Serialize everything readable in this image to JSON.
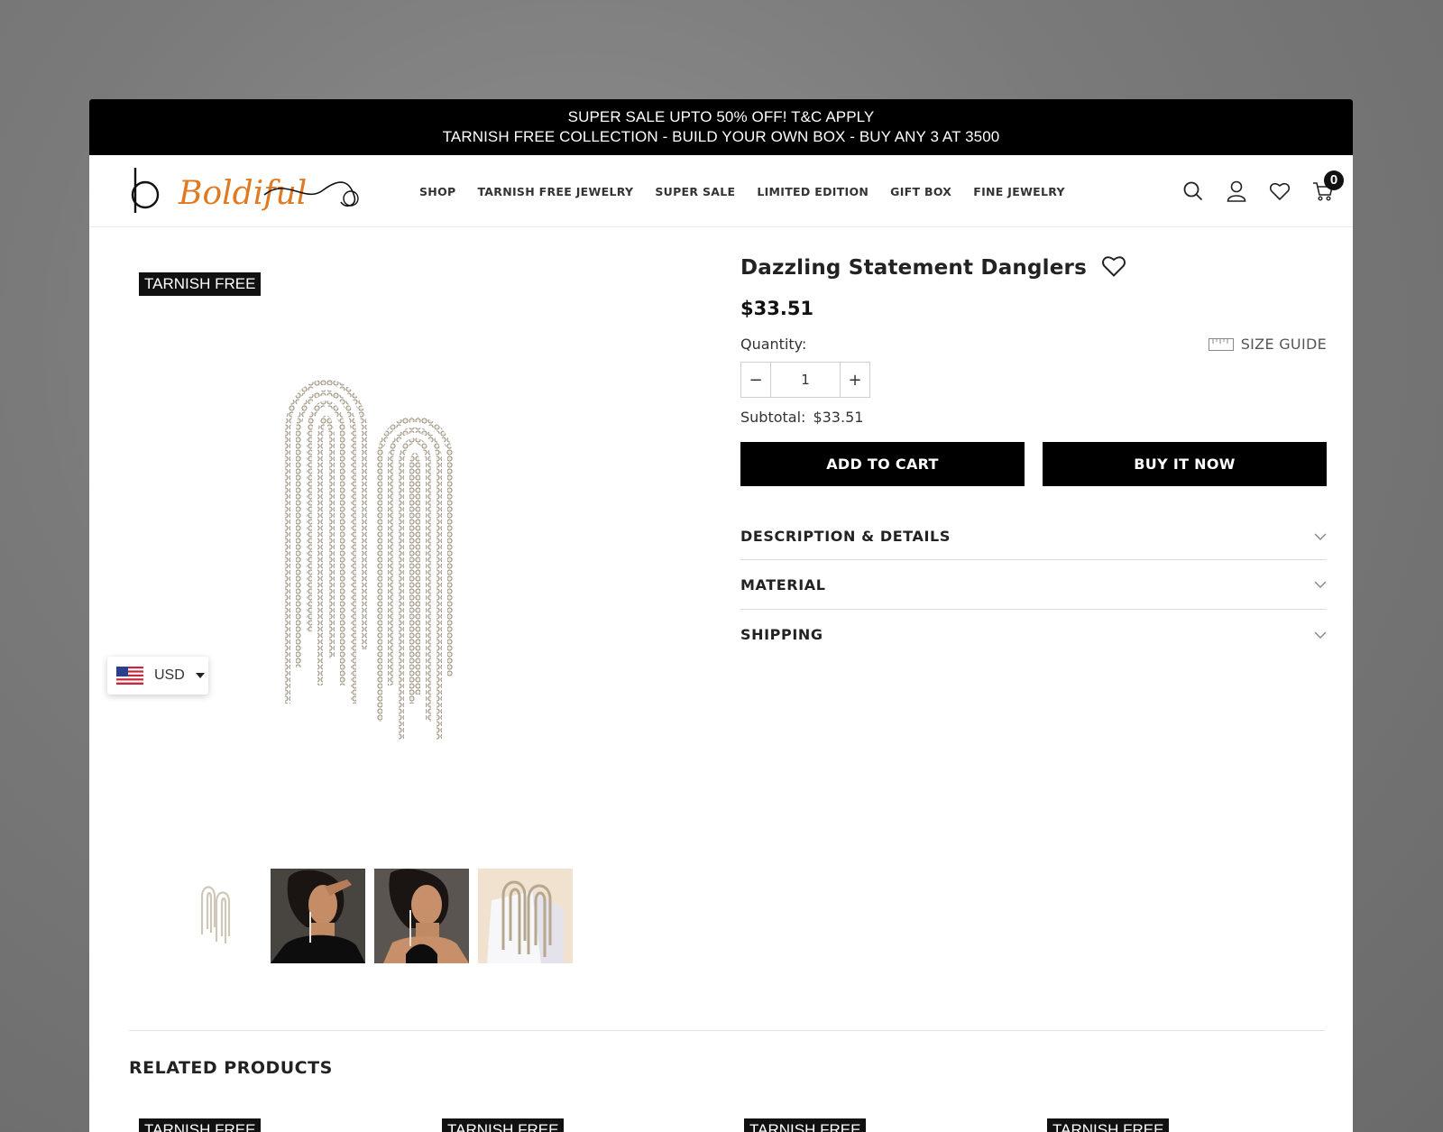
{
  "announcement": {
    "line1": "SUPER SALE UPTO 50% OFF! T&C APPLY",
    "line2": "TARNISH FREE COLLECTION - BUILD YOUR OWN BOX - BUY ANY 3 AT 3500"
  },
  "brand": {
    "logo_text": "Boldiful",
    "logo_letter": "b",
    "accent": "#e07a22"
  },
  "nav": {
    "items": [
      "SHOP",
      "TARNISH FREE JEWELRY",
      "SUPER SALE",
      "LIMITED EDITION",
      "GIFT BOX",
      "FINE JEWELRY"
    ]
  },
  "header_icons": [
    "search-icon",
    "account-icon",
    "wishlist-icon",
    "cart-icon"
  ],
  "cart": {
    "count": "0"
  },
  "gallery": {
    "badge": "TARNISH FREE",
    "thumbnails": [
      "earrings-product",
      "model-side-view",
      "model-eyes-closed",
      "earrings-on-stand"
    ]
  },
  "currency": {
    "code": "USD"
  },
  "product": {
    "title": "Dazzling Statement Danglers",
    "price": "$33.51",
    "quantity_label": "Quantity:",
    "quantity": "1",
    "size_guide": "SIZE GUIDE",
    "subtotal_label": "Subtotal:",
    "subtotal_value": "$33.51",
    "add_to_cart": "ADD TO CART",
    "buy_now": "BUY IT NOW"
  },
  "accordion": {
    "items": [
      "DESCRIPTION & DETAILS",
      "MATERIAL",
      "SHIPPING"
    ]
  },
  "related": {
    "title": "RELATED PRODUCTS",
    "badges": [
      "TARNISH FREE",
      "TARNISH FREE",
      "TARNISH FREE",
      "TARNISH FREE"
    ]
  }
}
